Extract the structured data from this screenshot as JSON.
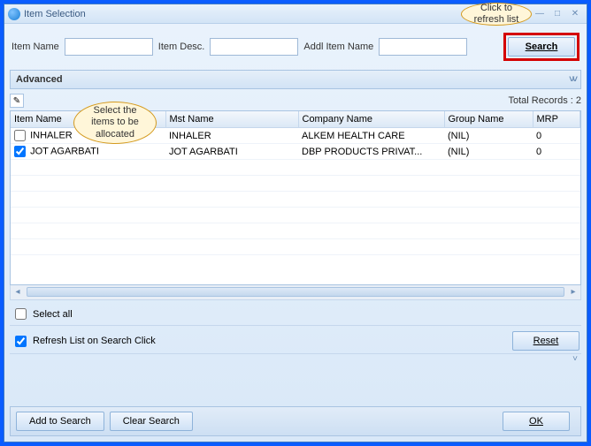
{
  "window": {
    "title": "Item Selection"
  },
  "search": {
    "item_name_label": "Item Name",
    "item_desc_label": "Item Desc.",
    "addl_name_label": "Addl Item Name",
    "search_btn": "Search",
    "item_name_value": "",
    "item_desc_value": "",
    "addl_name_value": ""
  },
  "advanced": {
    "label": "Advanced"
  },
  "records": {
    "total_label": "Total Records : 2"
  },
  "columns": {
    "c0": "Item Name",
    "c1": "Mst Name",
    "c2": "Company Name",
    "c3": "Group Name",
    "c4": "MRP"
  },
  "rows": [
    {
      "checked": false,
      "item_name": "INHALER",
      "mst_name": "INHALER",
      "company": "ALKEM HEALTH CARE",
      "group": "(NIL)",
      "mrp": "0"
    },
    {
      "checked": true,
      "item_name": "JOT AGARBATI",
      "mst_name": "JOT AGARBATI",
      "company": "DBP PRODUCTS PRIVAT...",
      "group": "(NIL)",
      "mrp": "0"
    }
  ],
  "select_all": {
    "label": "Select all",
    "checked": false
  },
  "refresh_on_search": {
    "label": "Refresh List on Search Click",
    "checked": true
  },
  "buttons": {
    "reset": "Reset",
    "add_to_search": "Add to Search",
    "clear_search": "Clear Search",
    "ok": "OK"
  },
  "callouts": {
    "refresh": "Click to refresh list",
    "select": "Select the items to be allocated"
  }
}
